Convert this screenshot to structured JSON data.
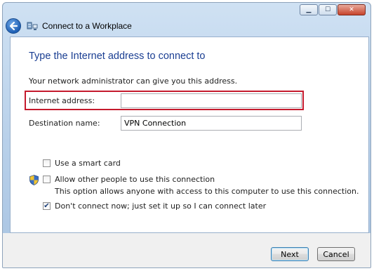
{
  "window": {
    "title": "Connect to a Workplace",
    "controls": {
      "minimize": "▁",
      "maximize": "☐",
      "close": "✕"
    }
  },
  "page": {
    "heading": "Type the Internet address to connect to",
    "instruction": "Your network administrator can give you this address."
  },
  "fields": {
    "internet_address": {
      "label": "Internet address:",
      "value": ""
    },
    "destination_name": {
      "label": "Destination name:",
      "value": "VPN Connection"
    }
  },
  "options": {
    "smart_card": {
      "label": "Use a smart card",
      "checked": false
    },
    "allow_others": {
      "label": "Allow other people to use this connection",
      "note": "This option allows anyone with access to this computer to use this connection.",
      "checked": false
    },
    "dont_connect": {
      "label": "Don't connect now; just set it up so I can connect later",
      "checked": true
    }
  },
  "buttons": {
    "next": "Next",
    "cancel": "Cancel"
  },
  "icons": {
    "back": "back-arrow-icon",
    "app": "network-workplace-icon",
    "shield": "uac-shield-icon"
  },
  "colors": {
    "heading": "#1a3e92",
    "highlight": "#c51a2d"
  }
}
